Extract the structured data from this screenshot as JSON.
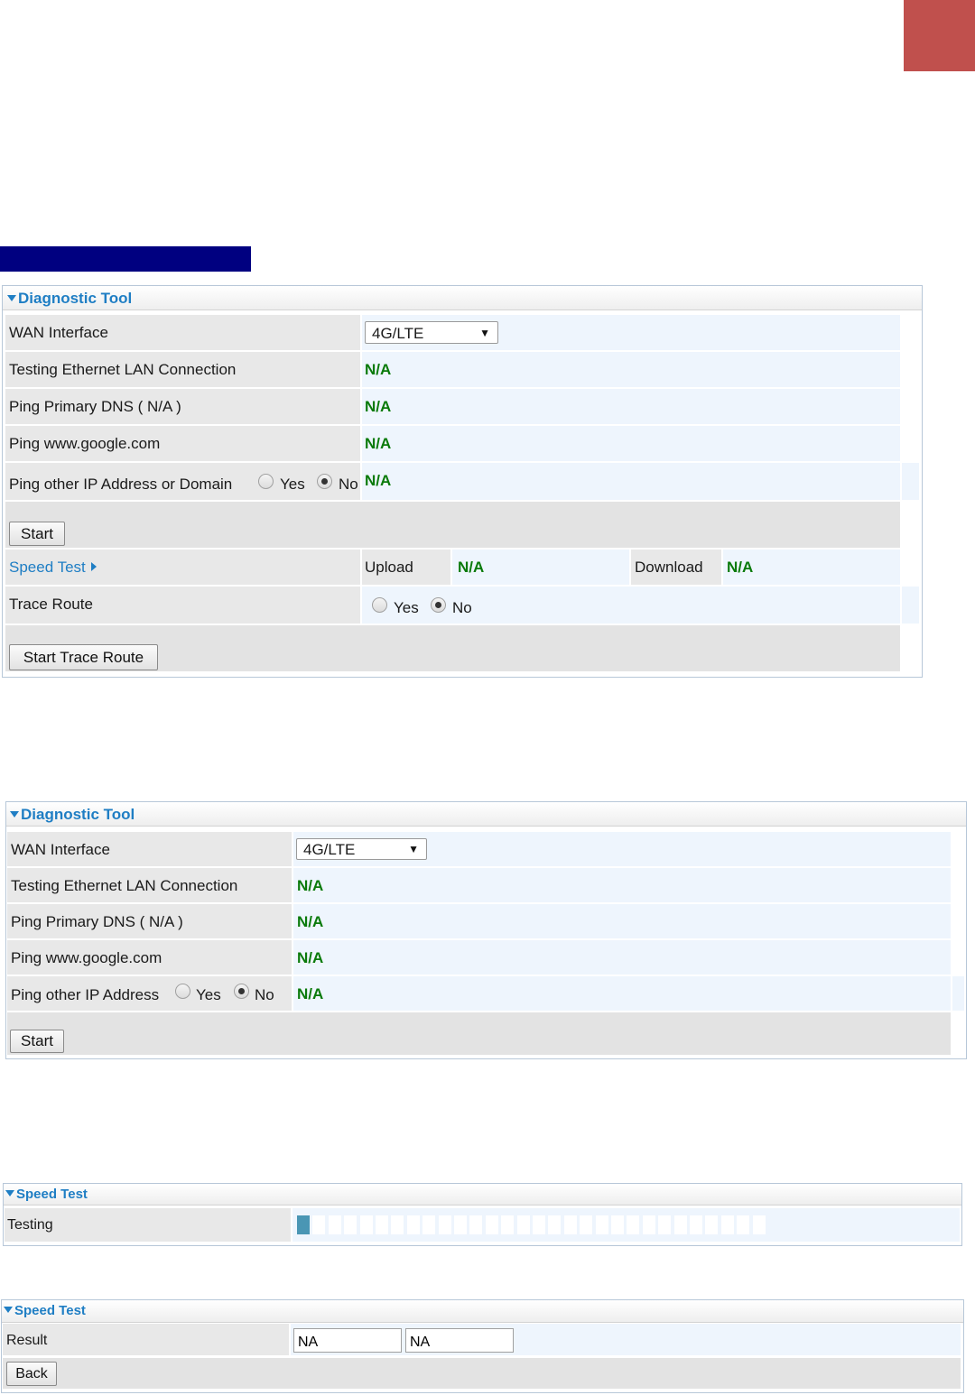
{
  "panel1": {
    "title": "Diagnostic Tool",
    "wan_label": "WAN Interface",
    "wan_value": "4G/LTE",
    "eth_label": "Testing Ethernet LAN Connection",
    "eth_value": "N/A",
    "dns_label": "Ping Primary DNS ( N/A )",
    "dns_value": "N/A",
    "google_label": "Ping www.google.com",
    "google_value": "N/A",
    "other_label": "Ping other IP Address or Domain",
    "other_yes": "Yes",
    "other_no": "No",
    "other_value": "N/A",
    "start_button": "Start",
    "speed_link": "Speed Test",
    "upload_label": "Upload",
    "upload_value": "N/A",
    "download_label": "Download",
    "download_value": "N/A",
    "trace_label": "Trace Route",
    "trace_yes": "Yes",
    "trace_no": "No",
    "trace_button": "Start Trace Route"
  },
  "panel2": {
    "title": "Diagnostic Tool",
    "wan_label": "WAN Interface",
    "wan_value": "4G/LTE",
    "eth_label": "Testing Ethernet LAN Connection",
    "eth_value": "N/A",
    "dns_label": "Ping Primary DNS ( N/A )",
    "dns_value": "N/A",
    "google_label": "Ping www.google.com",
    "google_value": "N/A",
    "other_label": "Ping other IP Address",
    "other_yes": "Yes",
    "other_no": "No",
    "other_value": "N/A",
    "start_button": "Start"
  },
  "panel3": {
    "title": "Speed Test",
    "testing_label": "Testing",
    "progress_segments_total": 30,
    "progress_segments_filled": 1
  },
  "panel4": {
    "title": "Speed Test",
    "result_label": "Result",
    "result_value_1": "NA",
    "result_value_2": "NA",
    "back_button": "Back"
  },
  "colors": {
    "corner_tab": "#c0504d",
    "dark_bar": "#000080",
    "header_text": "#1f7ec4",
    "na_text": "#0a7a0a",
    "progress_fill": "#4a96b4"
  }
}
